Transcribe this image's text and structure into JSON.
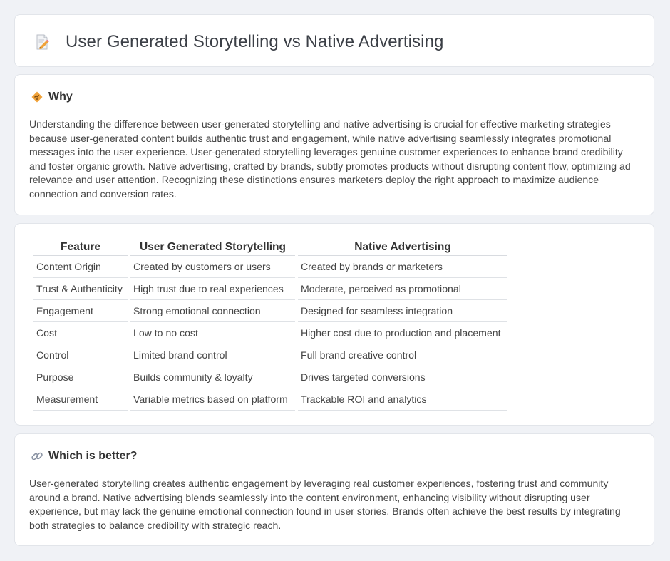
{
  "page": {
    "title": "User Generated Storytelling vs Native Advertising",
    "title_icon": "document-pencil-icon"
  },
  "why": {
    "heading": "Why",
    "icon": "diamond-warning-icon",
    "text": "Understanding the difference between user-generated storytelling and native advertising is crucial for effective marketing strategies because user-generated content builds authentic trust and engagement, while native advertising seamlessly integrates promotional messages into the user experience. User-generated storytelling leverages genuine customer experiences to enhance brand credibility and foster organic growth. Native advertising, crafted by brands, subtly promotes products without disrupting content flow, optimizing ad relevance and user attention. Recognizing these distinctions ensures marketers deploy the right approach to maximize audience connection and conversion rates."
  },
  "table": {
    "headers": [
      "Feature",
      "User Generated Storytelling",
      "Native Advertising"
    ],
    "rows": [
      [
        "Content Origin",
        "Created by customers or users",
        "Created by brands or marketers"
      ],
      [
        "Trust & Authenticity",
        "High trust due to real experiences",
        "Moderate, perceived as promotional"
      ],
      [
        "Engagement",
        "Strong emotional connection",
        "Designed for seamless integration"
      ],
      [
        "Cost",
        "Low to no cost",
        "Higher cost due to production and placement"
      ],
      [
        "Control",
        "Limited brand control",
        "Full brand creative control"
      ],
      [
        "Purpose",
        "Builds community & loyalty",
        "Drives targeted conversions"
      ],
      [
        "Measurement",
        "Variable metrics based on platform",
        "Trackable ROI and analytics"
      ]
    ]
  },
  "better": {
    "heading": "Which is better?",
    "icon": "link-icon",
    "text": "User-generated storytelling creates authentic engagement by leveraging real customer experiences, fostering trust and community around a brand. Native advertising blends seamlessly into the content environment, enhancing visibility without disrupting user experience, but may lack the genuine emotional connection found in user stories. Brands often achieve the best results by integrating both strategies to balance credibility with strategic reach."
  },
  "colors": {
    "background": "#f0f2f6",
    "card": "#ffffff",
    "border": "#e2e5ea",
    "accent_orange": "#f0a23a",
    "accent_pink": "#e9677a"
  }
}
